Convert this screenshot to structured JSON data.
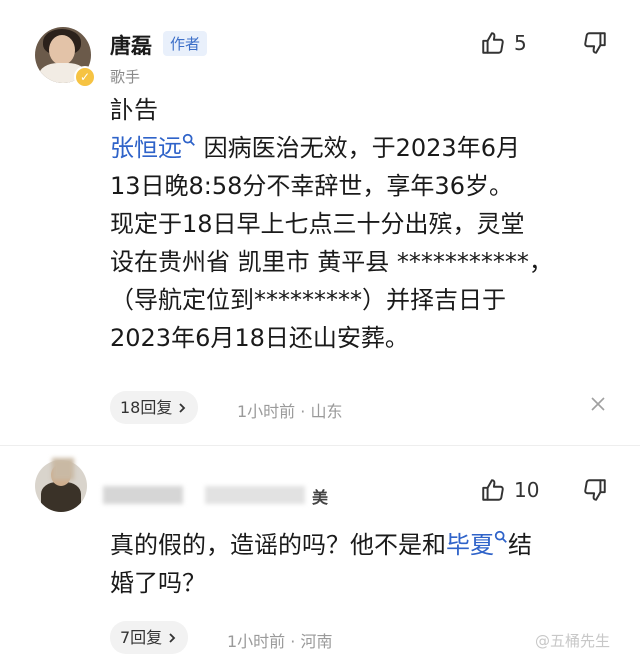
{
  "comment1": {
    "user_name": "唐磊",
    "author_tag": "作者",
    "subtitle": "歌手",
    "likes": "5",
    "text_line1": "訃告",
    "link_name": "张恒远",
    "text_after_link": " 因病医治无效，于2023年6月",
    "text_line3": "13日晚8:58分不幸辞世，享年36岁。",
    "text_line4": "现定于18日早上七点三十分出殡，灵堂",
    "text_line5": "设在贵州省 凯里市 黄平县 ***********，",
    "text_line6": "（导航定位到*********）并择吉日于",
    "text_line7": "2023年6月18日还山安葬。",
    "replies_label": "18回复",
    "meta": "1小时前 · 山东"
  },
  "comment2": {
    "user_name_suffix": "美",
    "likes": "10",
    "text_part1": "真的假的，造谣的吗？他不是和",
    "link_name": "毕夏",
    "text_part2": "结",
    "text_line2": "婚了吗？",
    "replies_label": "7回复",
    "meta": "1小时前 · 河南"
  },
  "watermark": "@五桶先生",
  "icons": {
    "like": "thumbs-up-icon",
    "dislike": "thumbs-down-icon",
    "close": "close-icon",
    "chevron": "chevron-right-icon",
    "search": "search-icon",
    "verified": "verified-badge-icon"
  },
  "colors": {
    "link": "#2f63c9",
    "author_tag_bg": "#e9f0fb",
    "author_tag_text": "#3d6fc8",
    "verified": "#f6c343"
  }
}
